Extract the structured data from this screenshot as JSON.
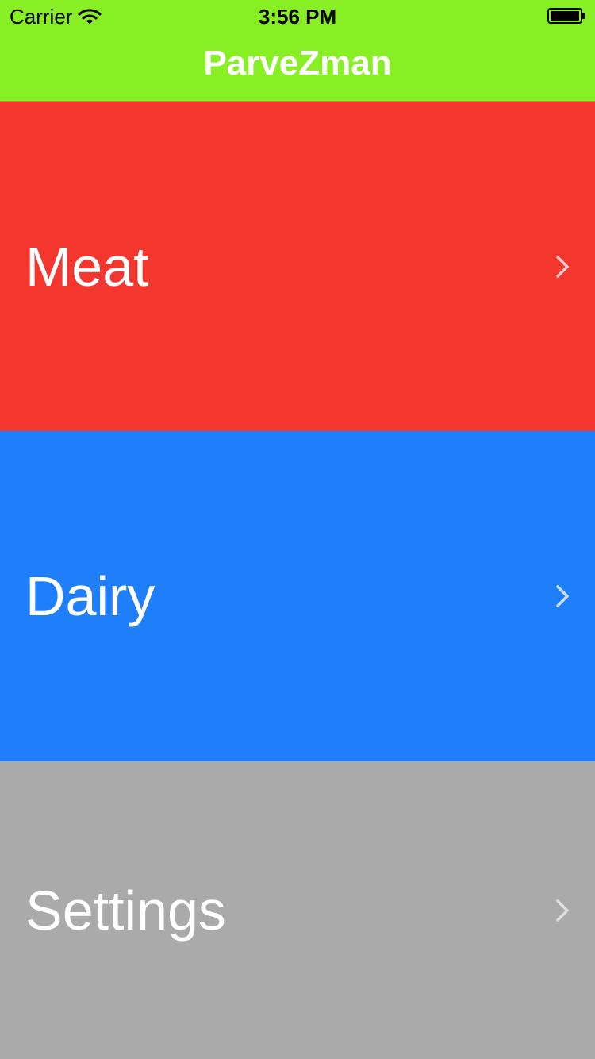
{
  "status_bar": {
    "carrier": "Carrier",
    "time": "3:56 PM",
    "wifi_icon": "wifi-icon",
    "battery_icon": "battery-icon"
  },
  "nav": {
    "title": "ParveZman",
    "background_color": "#88ef24"
  },
  "menu": {
    "items": [
      {
        "label": "Meat",
        "color": "#f3372f",
        "icon": "chevron-right-icon"
      },
      {
        "label": "Dairy",
        "color": "#1f7ffb",
        "icon": "chevron-right-icon"
      },
      {
        "label": "Settings",
        "color": "#aaaaaa",
        "icon": "chevron-right-icon"
      }
    ]
  }
}
